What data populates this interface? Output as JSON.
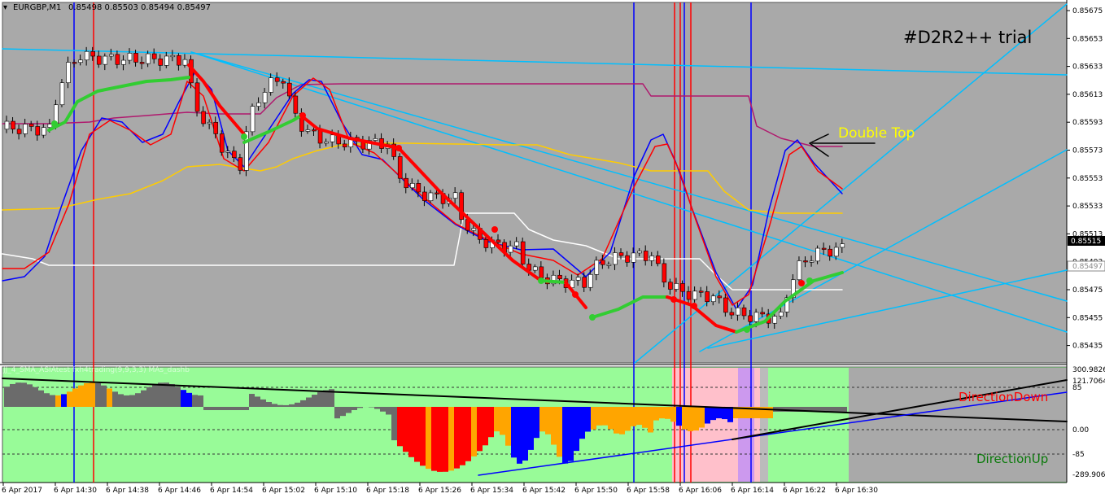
{
  "header": {
    "symbol": "EURGBP,M1",
    "ohlc": "0.85498 0.85503 0.85494 0.85497",
    "indicator_label": "JJ_4_SMA_ASIAtest fxh4trading(9,9,3,3) MAs_dashb"
  },
  "annotations": {
    "trial": "#D2R2++ trial",
    "double_top": "Double Top",
    "direction_down": "DirectionDown",
    "direction_up": "DirectionUp"
  },
  "price_axis": {
    "labels": [
      "0.85675",
      "0.85653",
      "0.85633",
      "0.85613",
      "0.85593",
      "0.85573",
      "0.85553",
      "0.85533",
      "0.85513",
      "0.85493",
      "0.85475",
      "0.85455",
      "0.85435"
    ],
    "current_price": "0.85515",
    "marker_price": "0.85497"
  },
  "osc_axis": {
    "labels": [
      "300.9826",
      "121.7064",
      "85",
      "0.00",
      "-85",
      "-289.9062"
    ]
  },
  "time_axis": {
    "labels": [
      "6 Apr 2017",
      "6 Apr 14:30",
      "6 Apr 14:38",
      "6 Apr 14:46",
      "6 Apr 14:54",
      "6 Apr 15:02",
      "6 Apr 15:10",
      "6 Apr 15:18",
      "6 Apr 15:26",
      "6 Apr 15:34",
      "6 Apr 15:42",
      "6 Apr 15:50",
      "6 Apr 15:58",
      "6 Apr 16:06",
      "6 Apr 16:14",
      "6 Apr 16:22",
      "6 Apr 16:30"
    ]
  },
  "colors": {
    "chart_bg": "#a9a9a9",
    "osc_bg": "#98fb98",
    "pink": "#ffc0cb",
    "violet": "#cc99ee",
    "red": "#ff0000",
    "blue": "#0000ff",
    "lime": "#32cd32",
    "orange": "#ffa500",
    "gold": "#ffcc00",
    "deepskyblue": "#00bfff",
    "magenta": "#c71585",
    "white": "#ffffff",
    "bull": "#ffffff",
    "bear": "#ff0000"
  }
}
